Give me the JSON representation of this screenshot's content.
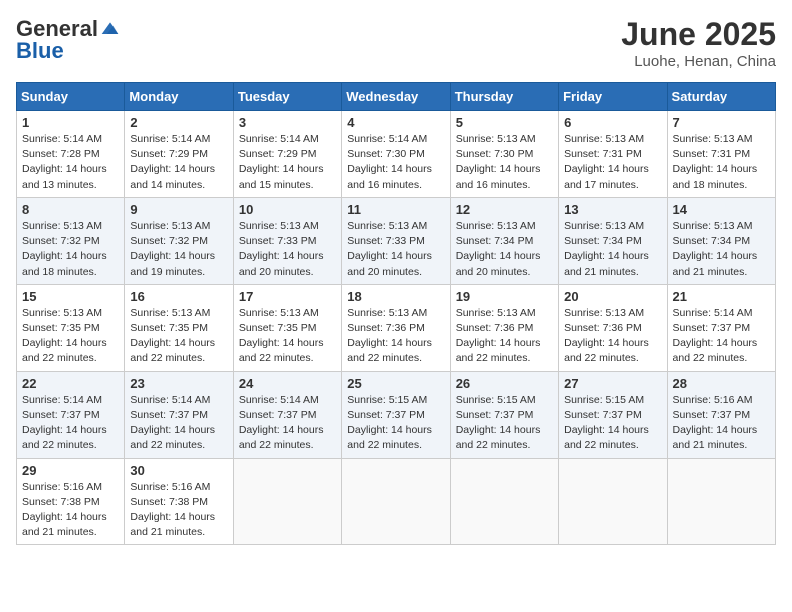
{
  "logo": {
    "general": "General",
    "blue": "Blue"
  },
  "title": "June 2025",
  "subtitle": "Luohe, Henan, China",
  "days_header": [
    "Sunday",
    "Monday",
    "Tuesday",
    "Wednesday",
    "Thursday",
    "Friday",
    "Saturday"
  ],
  "weeks": [
    [
      {
        "day": "1",
        "info": "Sunrise: 5:14 AM\nSunset: 7:28 PM\nDaylight: 14 hours\nand 13 minutes."
      },
      {
        "day": "2",
        "info": "Sunrise: 5:14 AM\nSunset: 7:29 PM\nDaylight: 14 hours\nand 14 minutes."
      },
      {
        "day": "3",
        "info": "Sunrise: 5:14 AM\nSunset: 7:29 PM\nDaylight: 14 hours\nand 15 minutes."
      },
      {
        "day": "4",
        "info": "Sunrise: 5:14 AM\nSunset: 7:30 PM\nDaylight: 14 hours\nand 16 minutes."
      },
      {
        "day": "5",
        "info": "Sunrise: 5:13 AM\nSunset: 7:30 PM\nDaylight: 14 hours\nand 16 minutes."
      },
      {
        "day": "6",
        "info": "Sunrise: 5:13 AM\nSunset: 7:31 PM\nDaylight: 14 hours\nand 17 minutes."
      },
      {
        "day": "7",
        "info": "Sunrise: 5:13 AM\nSunset: 7:31 PM\nDaylight: 14 hours\nand 18 minutes."
      }
    ],
    [
      {
        "day": "8",
        "info": "Sunrise: 5:13 AM\nSunset: 7:32 PM\nDaylight: 14 hours\nand 18 minutes."
      },
      {
        "day": "9",
        "info": "Sunrise: 5:13 AM\nSunset: 7:32 PM\nDaylight: 14 hours\nand 19 minutes."
      },
      {
        "day": "10",
        "info": "Sunrise: 5:13 AM\nSunset: 7:33 PM\nDaylight: 14 hours\nand 20 minutes."
      },
      {
        "day": "11",
        "info": "Sunrise: 5:13 AM\nSunset: 7:33 PM\nDaylight: 14 hours\nand 20 minutes."
      },
      {
        "day": "12",
        "info": "Sunrise: 5:13 AM\nSunset: 7:34 PM\nDaylight: 14 hours\nand 20 minutes."
      },
      {
        "day": "13",
        "info": "Sunrise: 5:13 AM\nSunset: 7:34 PM\nDaylight: 14 hours\nand 21 minutes."
      },
      {
        "day": "14",
        "info": "Sunrise: 5:13 AM\nSunset: 7:34 PM\nDaylight: 14 hours\nand 21 minutes."
      }
    ],
    [
      {
        "day": "15",
        "info": "Sunrise: 5:13 AM\nSunset: 7:35 PM\nDaylight: 14 hours\nand 22 minutes."
      },
      {
        "day": "16",
        "info": "Sunrise: 5:13 AM\nSunset: 7:35 PM\nDaylight: 14 hours\nand 22 minutes."
      },
      {
        "day": "17",
        "info": "Sunrise: 5:13 AM\nSunset: 7:35 PM\nDaylight: 14 hours\nand 22 minutes."
      },
      {
        "day": "18",
        "info": "Sunrise: 5:13 AM\nSunset: 7:36 PM\nDaylight: 14 hours\nand 22 minutes."
      },
      {
        "day": "19",
        "info": "Sunrise: 5:13 AM\nSunset: 7:36 PM\nDaylight: 14 hours\nand 22 minutes."
      },
      {
        "day": "20",
        "info": "Sunrise: 5:13 AM\nSunset: 7:36 PM\nDaylight: 14 hours\nand 22 minutes."
      },
      {
        "day": "21",
        "info": "Sunrise: 5:14 AM\nSunset: 7:37 PM\nDaylight: 14 hours\nand 22 minutes."
      }
    ],
    [
      {
        "day": "22",
        "info": "Sunrise: 5:14 AM\nSunset: 7:37 PM\nDaylight: 14 hours\nand 22 minutes."
      },
      {
        "day": "23",
        "info": "Sunrise: 5:14 AM\nSunset: 7:37 PM\nDaylight: 14 hours\nand 22 minutes."
      },
      {
        "day": "24",
        "info": "Sunrise: 5:14 AM\nSunset: 7:37 PM\nDaylight: 14 hours\nand 22 minutes."
      },
      {
        "day": "25",
        "info": "Sunrise: 5:15 AM\nSunset: 7:37 PM\nDaylight: 14 hours\nand 22 minutes."
      },
      {
        "day": "26",
        "info": "Sunrise: 5:15 AM\nSunset: 7:37 PM\nDaylight: 14 hours\nand 22 minutes."
      },
      {
        "day": "27",
        "info": "Sunrise: 5:15 AM\nSunset: 7:37 PM\nDaylight: 14 hours\nand 22 minutes."
      },
      {
        "day": "28",
        "info": "Sunrise: 5:16 AM\nSunset: 7:37 PM\nDaylight: 14 hours\nand 21 minutes."
      }
    ],
    [
      {
        "day": "29",
        "info": "Sunrise: 5:16 AM\nSunset: 7:38 PM\nDaylight: 14 hours\nand 21 minutes."
      },
      {
        "day": "30",
        "info": "Sunrise: 5:16 AM\nSunset: 7:38 PM\nDaylight: 14 hours\nand 21 minutes."
      },
      {
        "day": "",
        "info": ""
      },
      {
        "day": "",
        "info": ""
      },
      {
        "day": "",
        "info": ""
      },
      {
        "day": "",
        "info": ""
      },
      {
        "day": "",
        "info": ""
      }
    ]
  ]
}
